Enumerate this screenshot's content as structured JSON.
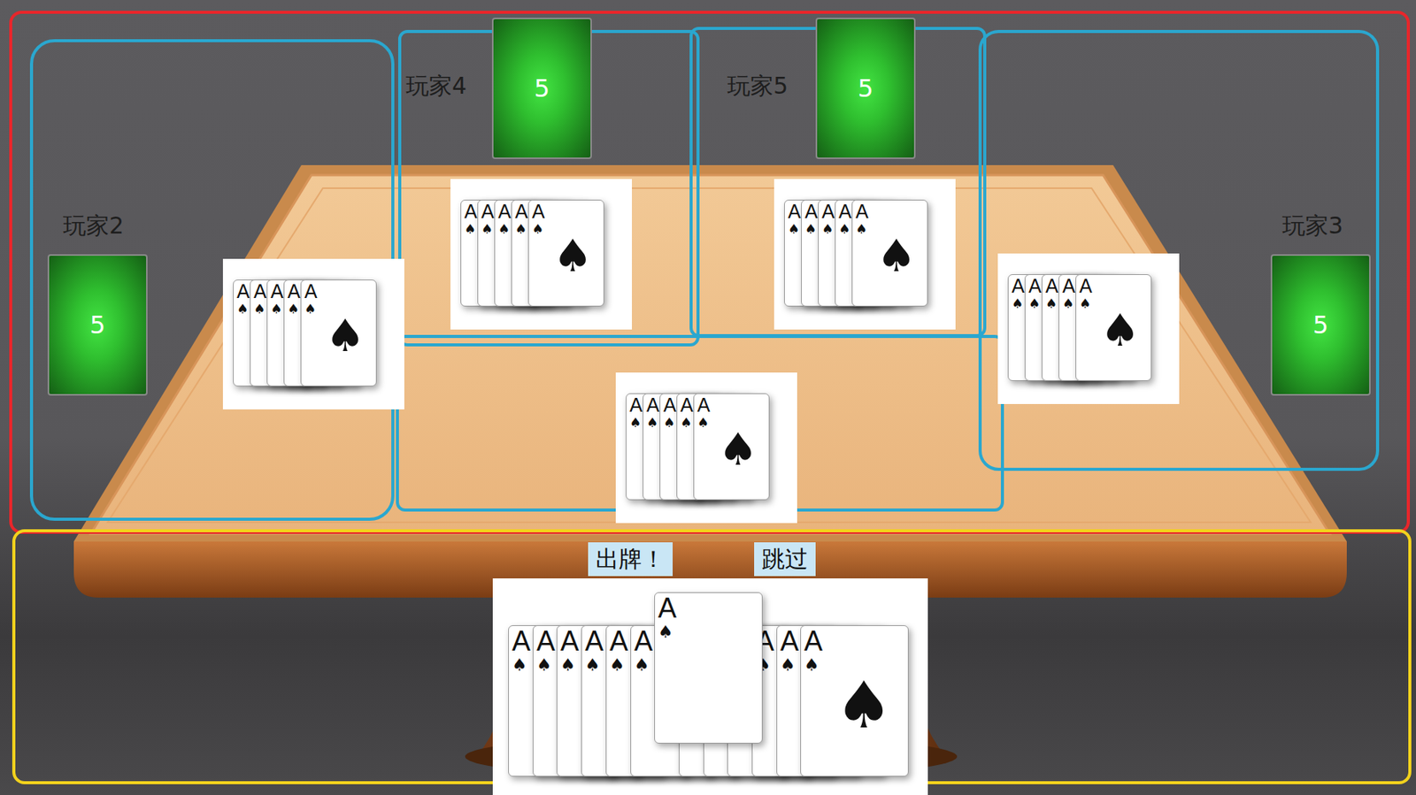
{
  "players": [
    {
      "label": "玩家2",
      "count": "5",
      "played": [
        {
          "rank": "A",
          "suit": "♠"
        },
        {
          "rank": "A",
          "suit": "♠"
        },
        {
          "rank": "A",
          "suit": "♠"
        },
        {
          "rank": "A",
          "suit": "♠"
        },
        {
          "rank": "A",
          "suit": "♠"
        }
      ]
    },
    {
      "label": "玩家4",
      "count": "5",
      "played": [
        {
          "rank": "A",
          "suit": "♠"
        },
        {
          "rank": "A",
          "suit": "♠"
        },
        {
          "rank": "A",
          "suit": "♠"
        },
        {
          "rank": "A",
          "suit": "♠"
        },
        {
          "rank": "A",
          "suit": "♠"
        }
      ]
    },
    {
      "label": "玩家5",
      "count": "5",
      "played": [
        {
          "rank": "A",
          "suit": "♠"
        },
        {
          "rank": "A",
          "suit": "♠"
        },
        {
          "rank": "A",
          "suit": "♠"
        },
        {
          "rank": "A",
          "suit": "♠"
        },
        {
          "rank": "A",
          "suit": "♠"
        }
      ]
    },
    {
      "label": "玩家3",
      "count": "5",
      "played": [
        {
          "rank": "A",
          "suit": "♠"
        },
        {
          "rank": "A",
          "suit": "♠"
        },
        {
          "rank": "A",
          "suit": "♠"
        },
        {
          "rank": "A",
          "suit": "♠"
        },
        {
          "rank": "A",
          "suit": "♠"
        }
      ]
    }
  ],
  "center": {
    "played": [
      {
        "rank": "A",
        "suit": "♠"
      },
      {
        "rank": "A",
        "suit": "♠"
      },
      {
        "rank": "A",
        "suit": "♠"
      },
      {
        "rank": "A",
        "suit": "♠"
      },
      {
        "rank": "A",
        "suit": "♠"
      }
    ]
  },
  "buttons": [
    {
      "label": "出牌！"
    },
    {
      "label": "跳过"
    }
  ],
  "hand": [
    {
      "rank": "A",
      "suit": "♠",
      "selected": false
    },
    {
      "rank": "A",
      "suit": "♠",
      "selected": false
    },
    {
      "rank": "A",
      "suit": "♠",
      "selected": false
    },
    {
      "rank": "A",
      "suit": "♠",
      "selected": false
    },
    {
      "rank": "A",
      "suit": "♠",
      "selected": false
    },
    {
      "rank": "A",
      "suit": "♠",
      "selected": false
    },
    {
      "rank": "A",
      "suit": "♠",
      "selected": true
    },
    {
      "rank": "A",
      "suit": "♠",
      "selected": false
    },
    {
      "rank": "A",
      "suit": "♠",
      "selected": false
    },
    {
      "rank": "A",
      "suit": "♠",
      "selected": false
    },
    {
      "rank": "A",
      "suit": "♠",
      "selected": false
    },
    {
      "rank": "A",
      "suit": "♠",
      "selected": false
    },
    {
      "rank": "A",
      "suit": "♠",
      "selected": false
    }
  ]
}
